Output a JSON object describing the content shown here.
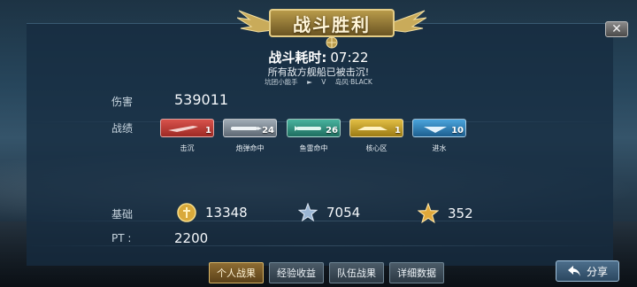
{
  "banner": {
    "title": "战斗胜利"
  },
  "battle": {
    "time_label": "战斗耗时:",
    "time_value": "07:22",
    "subtitle": "所有敌方舰船已被击沉!",
    "player_left": "坑团小能手",
    "flag_icon": "flag-icon",
    "vs": "V",
    "player_right": "岛风·BLACK"
  },
  "labels": {
    "damage": "伤害",
    "record": "战绩",
    "base": "基础",
    "pt": "PT :"
  },
  "damage_value": "539011",
  "badges": [
    {
      "icon": "plane-icon",
      "count": "1",
      "label": "击沉",
      "color": "#c63a34"
    },
    {
      "icon": "shell-icon",
      "count": "24",
      "label": "炮弹命中",
      "color": "#7e8a96"
    },
    {
      "icon": "torpedo-icon",
      "count": "26",
      "label": "鱼雷命中",
      "color": "#2f8f7e"
    },
    {
      "icon": "core-icon",
      "count": "1",
      "label": "核心区",
      "color": "#c9a226"
    },
    {
      "icon": "water-icon",
      "count": "10",
      "label": "进水",
      "color": "#2f8ac6"
    }
  ],
  "stats": {
    "gold_value": "13348",
    "silver_star_value": "7054",
    "gold_star_value": "352",
    "pt_value": "2200"
  },
  "tabs": [
    {
      "label": "个人战果",
      "active": true
    },
    {
      "label": "经验收益",
      "active": false
    },
    {
      "label": "队伍战果",
      "active": false
    },
    {
      "label": "详细数据",
      "active": false
    }
  ],
  "share_label": "分享",
  "colors": {
    "panel": "#162c40",
    "active_tab": "#8e6d33",
    "gold": "#d9a93a"
  }
}
